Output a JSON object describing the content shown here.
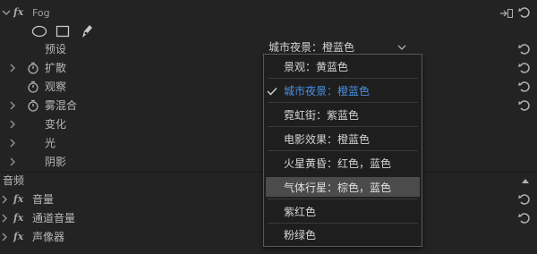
{
  "effect": {
    "name": "Fog",
    "fx_label": "fx"
  },
  "properties": [
    {
      "label": "预设",
      "indent": "plain",
      "has_chevron": false,
      "has_stopwatch": false
    },
    {
      "label": "扩散",
      "has_chevron": true,
      "has_stopwatch": true
    },
    {
      "label": "观察",
      "has_chevron": false,
      "has_stopwatch": true
    },
    {
      "label": "雾混合",
      "has_chevron": true,
      "has_stopwatch": true
    },
    {
      "label": "变化",
      "has_chevron": true,
      "has_stopwatch": false
    },
    {
      "label": "光",
      "has_chevron": true,
      "has_stopwatch": false
    },
    {
      "label": "阴影",
      "has_chevron": true,
      "has_stopwatch": false
    }
  ],
  "preset_select": {
    "value": "城市夜景：橙蓝色"
  },
  "dropdown": {
    "items": [
      {
        "label": "景观：黄蓝色",
        "checked": false,
        "highlighted": false
      },
      {
        "label": "城市夜景：橙蓝色",
        "checked": true,
        "highlighted": false
      },
      {
        "label": "霓虹街：紫蓝色",
        "checked": false,
        "highlighted": false
      },
      {
        "label": "电影效果：橙蓝色",
        "checked": false,
        "highlighted": false
      },
      {
        "label": "火星黄昏：红色，蓝色",
        "checked": false,
        "highlighted": false
      },
      {
        "label": "气体行星：棕色，蓝色",
        "checked": false,
        "highlighted": true
      },
      {
        "label": "紫红色",
        "checked": false,
        "highlighted": false
      },
      {
        "label": "粉绿色",
        "checked": false,
        "highlighted": false
      }
    ]
  },
  "audio_section": {
    "title": "音频",
    "effects": [
      {
        "fx": "fx",
        "label": "音量"
      },
      {
        "fx": "fx",
        "label": "通道音量"
      },
      {
        "fx": "fx",
        "label": "声像器"
      }
    ]
  },
  "colors": {
    "background": "#232323",
    "text": "#b8b8b8",
    "accent_blue": "#4a90e2",
    "highlight": "#4b4b4b"
  }
}
